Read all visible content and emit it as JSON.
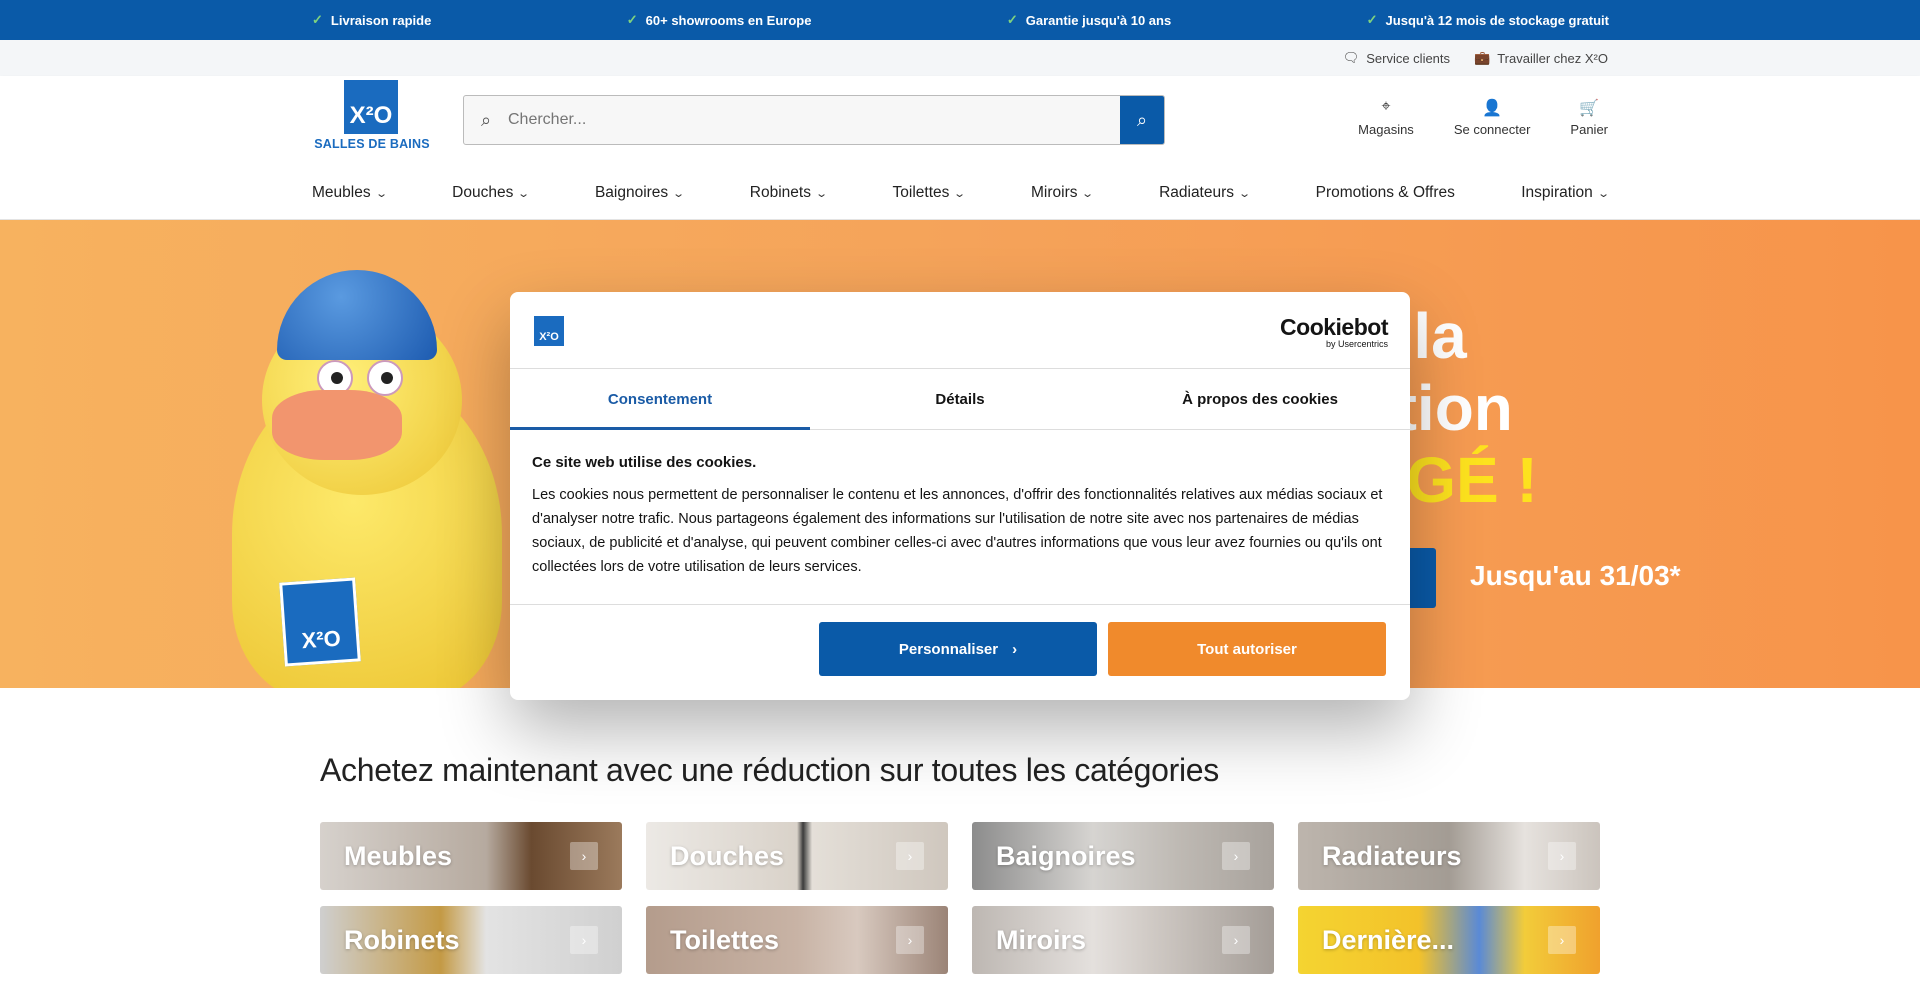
{
  "usp": [
    {
      "icon": "check-icon",
      "text": "Livraison rapide"
    },
    {
      "icon": "check-icon",
      "text": "60+ showrooms en Europe"
    },
    {
      "icon": "check-icon",
      "text": "Garantie jusqu'à 10 ans"
    },
    {
      "icon": "check-icon",
      "text": "Jusqu'à 12 mois de stockage gratuit"
    }
  ],
  "utility": {
    "service": "Service clients",
    "jobs": "Travailler chez X²O"
  },
  "logo": {
    "mark": "X²O",
    "text": "SALLES DE BAINS"
  },
  "search": {
    "placeholder": "Chercher...",
    "value": ""
  },
  "actions": {
    "stores": "Magasins",
    "login": "Se connecter",
    "cart": "Panier"
  },
  "nav": [
    {
      "label": "Meubles",
      "dropdown": true
    },
    {
      "label": "Douches",
      "dropdown": true
    },
    {
      "label": "Baignoires",
      "dropdown": true
    },
    {
      "label": "Robinets",
      "dropdown": true
    },
    {
      "label": "Toilettes",
      "dropdown": true
    },
    {
      "label": "Miroirs",
      "dropdown": true
    },
    {
      "label": "Radiateurs",
      "dropdown": true
    },
    {
      "label": "Promotions & Offres",
      "dropdown": false
    },
    {
      "label": "Inspiration",
      "dropdown": true
    }
  ],
  "hero": {
    "line1": "e la",
    "line2": "ction",
    "line3": "NGÉ !",
    "date": "Jusqu'au 31/03*"
  },
  "cookie": {
    "brand": "Cookiebot",
    "brand_sub": "by Usercentrics",
    "tabs": [
      "Consentement",
      "Détails",
      "À propos des cookies"
    ],
    "active_tab": "Consentement",
    "heading": "Ce site web utilise des cookies.",
    "body": "Les cookies nous permettent de personnaliser le contenu et les annonces, d'offrir des fonctionnalités relatives aux médias sociaux et d'analyser notre trafic. Nous partageons également des informations sur l'utilisation de notre site avec nos partenaires de médias sociaux, de publicité et d'analyse, qui peuvent combiner celles-ci avec d'autres informations que vous leur avez fournies ou qu'ils ont collectées lors de votre utilisation de leurs services.",
    "customize": "Personnaliser",
    "accept": "Tout autoriser"
  },
  "categories": {
    "title": "Achetez maintenant avec une réduction sur toutes les catégories",
    "items": [
      "Meubles",
      "Douches",
      "Baignoires",
      "Radiateurs",
      "Robinets",
      "Toilettes",
      "Miroirs",
      "Dernière..."
    ]
  },
  "colors": {
    "primary": "#0a5aa8",
    "accent": "#f08a2c",
    "hero": "#f6a85a"
  }
}
